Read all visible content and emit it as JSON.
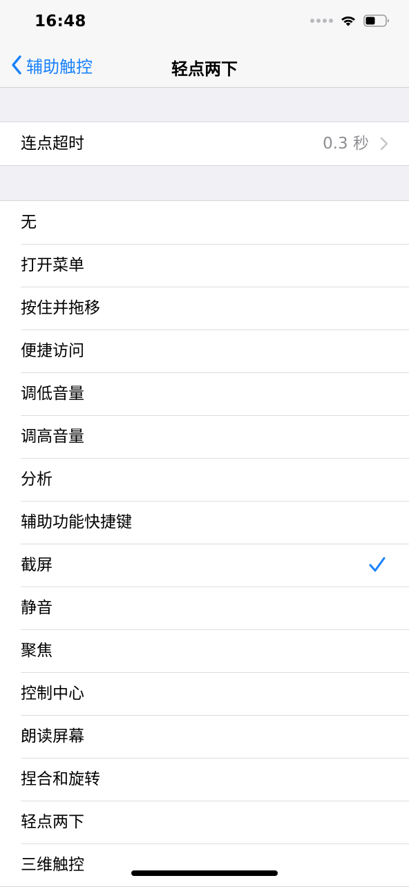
{
  "status_bar": {
    "time": "16:48",
    "icons": [
      "signal-dots-icon",
      "wifi-icon",
      "battery-icon"
    ]
  },
  "nav": {
    "back_label": "辅助触控",
    "title": "轻点两下"
  },
  "timeout_row": {
    "label": "连点超时",
    "value": "0.3 秒"
  },
  "options": [
    {
      "label": "无",
      "selected": false
    },
    {
      "label": "打开菜单",
      "selected": false
    },
    {
      "label": "按住并拖移",
      "selected": false
    },
    {
      "label": "便捷访问",
      "selected": false
    },
    {
      "label": "调低音量",
      "selected": false
    },
    {
      "label": "调高音量",
      "selected": false
    },
    {
      "label": "分析",
      "selected": false
    },
    {
      "label": "辅助功能快捷键",
      "selected": false
    },
    {
      "label": "截屏",
      "selected": true
    },
    {
      "label": "静音",
      "selected": false
    },
    {
      "label": "聚焦",
      "selected": false
    },
    {
      "label": "控制中心",
      "selected": false
    },
    {
      "label": "朗读屏幕",
      "selected": false
    },
    {
      "label": "捏合和旋转",
      "selected": false
    },
    {
      "label": "轻点两下",
      "selected": false
    },
    {
      "label": "三维触控",
      "selected": false
    }
  ],
  "colors": {
    "accent": "#1a82fb",
    "secondary_text": "#8e8e93",
    "grouped_background": "#f1f1f5"
  }
}
